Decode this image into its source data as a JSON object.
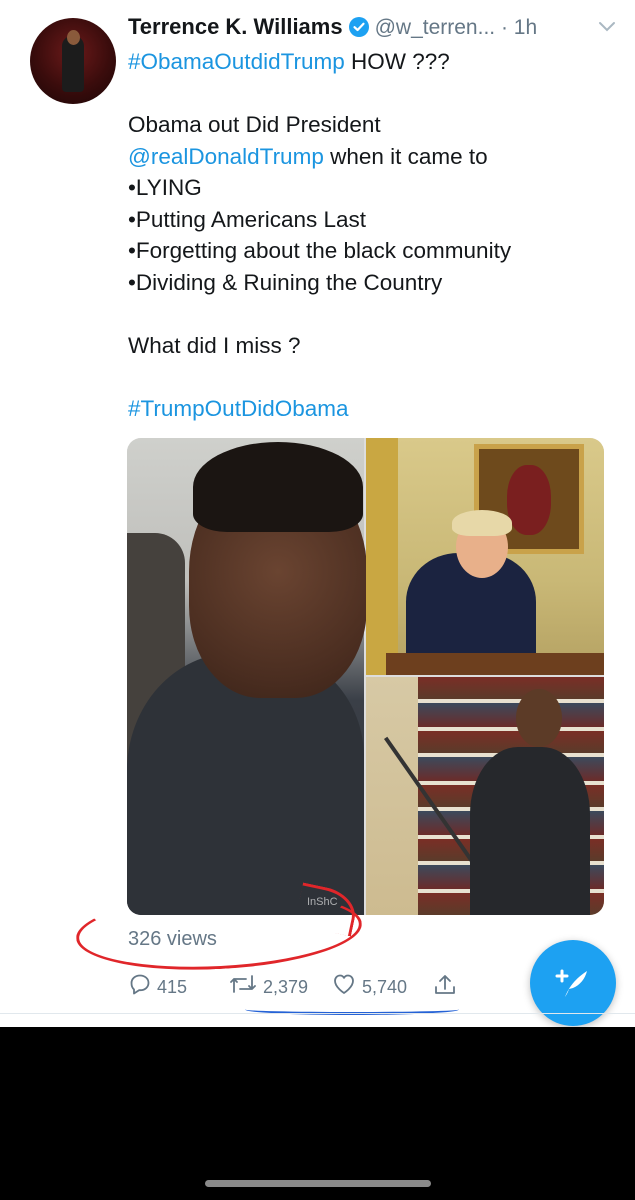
{
  "tweet": {
    "author_name": "Terrence K. Williams",
    "handle": "@w_terren...",
    "time": " · 1h",
    "line1_hashtag": "#ObamaOutdidTrump",
    "line1_rest": " HOW ???",
    "line3": "Obama out Did President",
    "line4_mention": "@realDonaldTrump",
    "line4_rest": " when it came to",
    "bullets": [
      "•LYING",
      "•Putting Americans Last",
      "•Forgetting about the black community",
      "•Dividing & Ruining the Country"
    ],
    "question": "What did I miss ?",
    "hashtag2": "#TrumpOutDidObama",
    "views": "326 views",
    "media_watermark": "InShC"
  },
  "actions": {
    "replies": "415",
    "retweets": "2,379",
    "likes": "5,740"
  },
  "colors": {
    "link": "#1b95e0",
    "fab": "#1da1f2",
    "annotation_red": "#e0262a",
    "annotation_blue": "#2562d6"
  },
  "icons": [
    "verified-icon",
    "chevron-down-icon",
    "reply-icon",
    "retweet-icon",
    "like-icon",
    "share-icon",
    "compose-icon"
  ]
}
